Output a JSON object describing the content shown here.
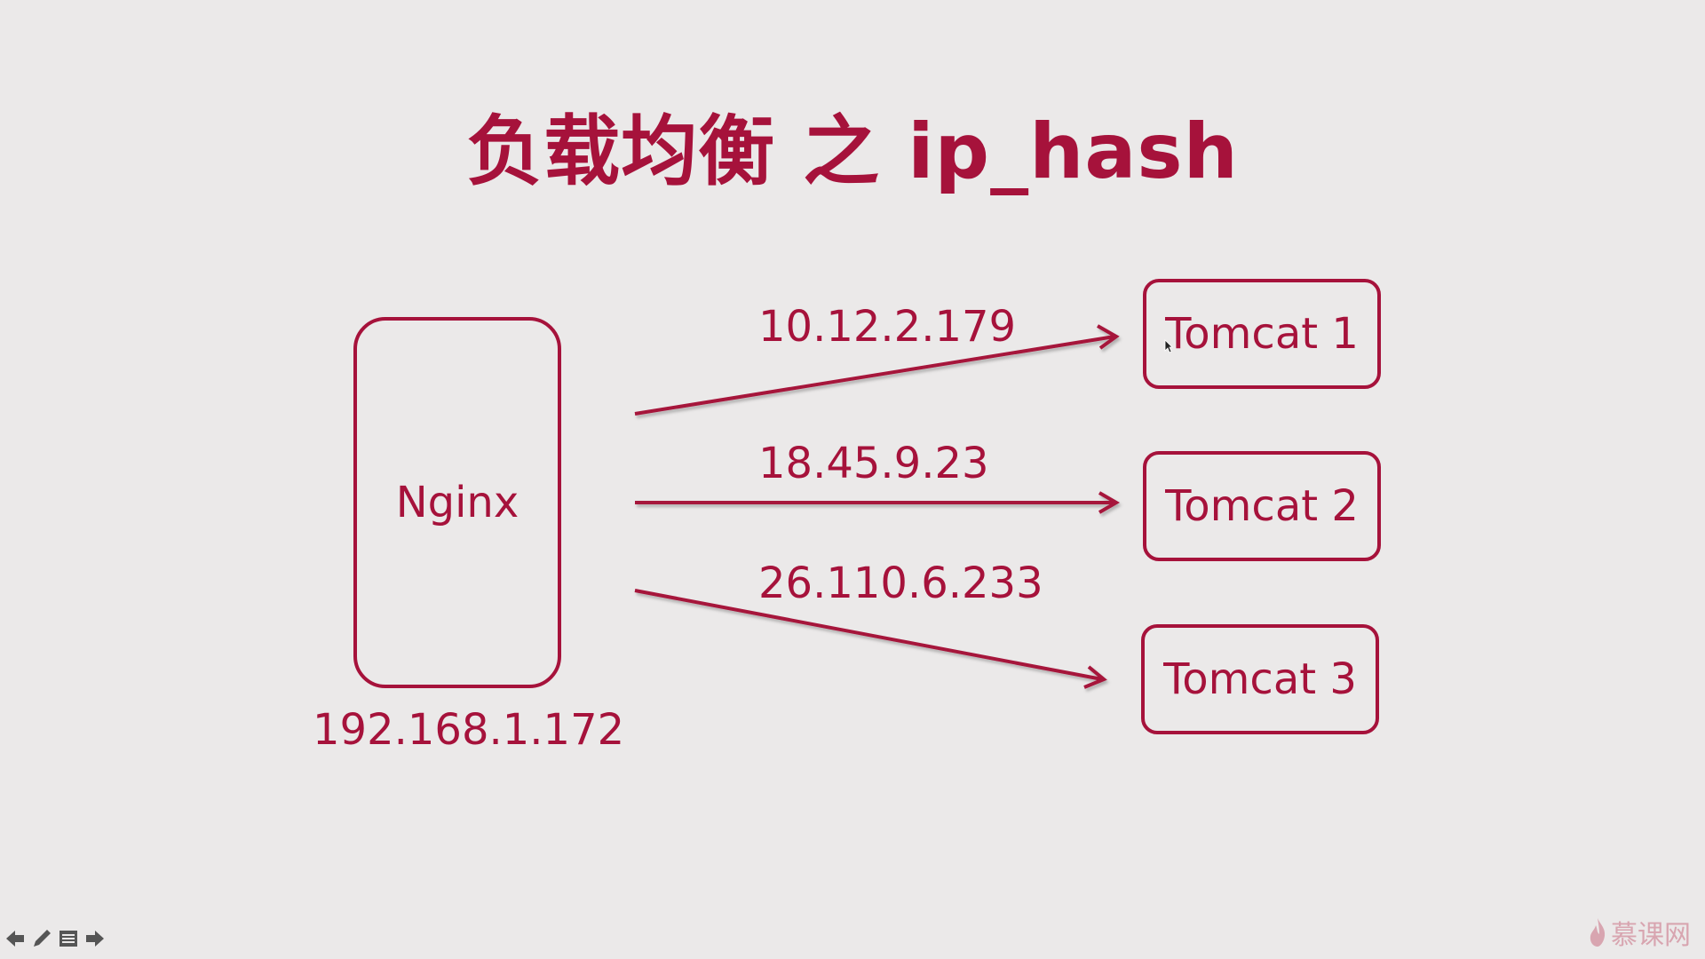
{
  "title": "负载均衡 之 ip_hash",
  "nginx": {
    "label": "Nginx",
    "ip": "192.168.1.172"
  },
  "servers": [
    {
      "label": "Tomcat 1",
      "client_ip": "10.12.2.179"
    },
    {
      "label": "Tomcat 2",
      "client_ip": "18.45.9.23"
    },
    {
      "label": "Tomcat 3",
      "client_ip": "26.110.6.233"
    }
  ],
  "colors": {
    "accent": "#a6123b",
    "background": "#ebe9e9"
  },
  "nav_icons": [
    "arrow-left-icon",
    "pen-icon",
    "menu-icon",
    "arrow-right-icon"
  ],
  "logo": {
    "text": "慕课网",
    "icon": "flame-icon"
  }
}
